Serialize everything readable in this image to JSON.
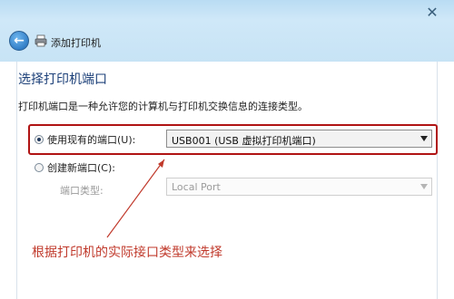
{
  "window": {
    "title": "添加打印机",
    "close_glyph": "✕"
  },
  "page": {
    "heading": "选择打印机端口",
    "description": "打印机端口是一种允许您的计算机与打印机交换信息的连接类型。"
  },
  "options": {
    "use_existing": {
      "label": "使用现有的端口(U):",
      "selected": true,
      "dropdown_value": "USB001 (USB 虚拟打印机端口)"
    },
    "create_new": {
      "label": "创建新端口(C):",
      "selected": false,
      "port_type_label": "端口类型:",
      "port_type_value": "Local Port"
    }
  },
  "annotation": {
    "text": "根据打印机的实际接口类型来选择",
    "color": "#c0392b"
  },
  "colors": {
    "highlight": "#b01313",
    "heading": "#1b3f78"
  }
}
